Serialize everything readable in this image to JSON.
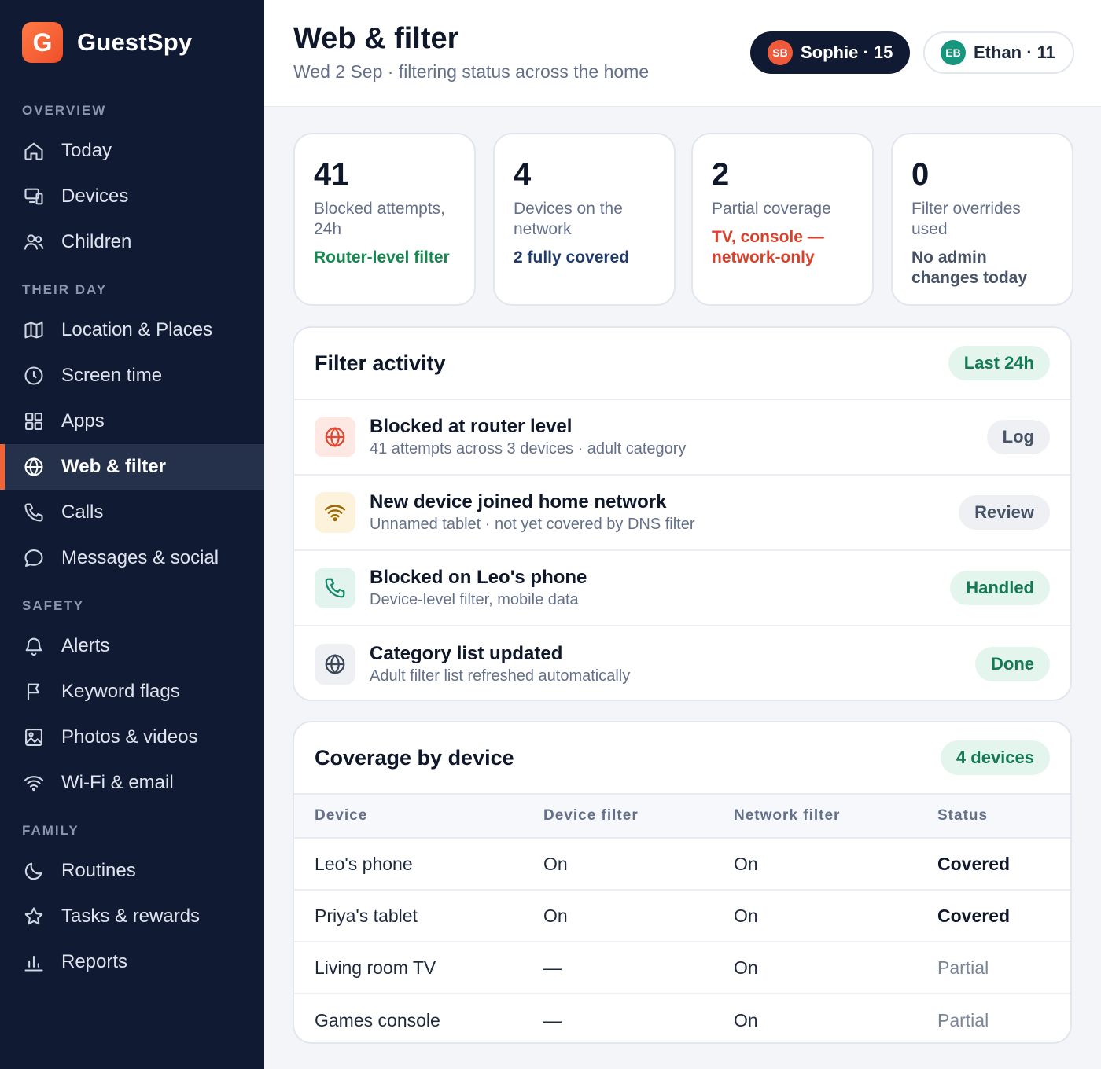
{
  "brand": {
    "logo_letter": "G",
    "name": "GuestSpy"
  },
  "sidebar": {
    "sections": [
      {
        "label": "OVERVIEW"
      },
      {
        "label": "THEIR DAY"
      },
      {
        "label": "SAFETY"
      },
      {
        "label": "FAMILY"
      }
    ],
    "items": [
      {
        "label": "Today",
        "icon": "home-icon"
      },
      {
        "label": "Devices",
        "icon": "devices-icon"
      },
      {
        "label": "Children",
        "icon": "people-icon"
      },
      {
        "label": "Location & Places",
        "icon": "map-icon"
      },
      {
        "label": "Screen time",
        "icon": "clock-icon"
      },
      {
        "label": "Apps",
        "icon": "grid-icon"
      },
      {
        "label": "Web & filter",
        "icon": "globe-icon",
        "active": true
      },
      {
        "label": "Calls",
        "icon": "phone-icon"
      },
      {
        "label": "Messages & social",
        "icon": "chat-icon"
      },
      {
        "label": "Alerts",
        "icon": "bell-icon"
      },
      {
        "label": "Keyword flags",
        "icon": "flag-icon"
      },
      {
        "label": "Photos & videos",
        "icon": "image-icon"
      },
      {
        "label": "Wi-Fi & email",
        "icon": "wifi-icon"
      },
      {
        "label": "Routines",
        "icon": "moon-icon"
      },
      {
        "label": "Tasks & rewards",
        "icon": "star-icon"
      },
      {
        "label": "Reports",
        "icon": "bar-chart-icon"
      }
    ]
  },
  "header": {
    "title": "Web & filter",
    "subtitle": "Wed 2 Sep · filtering status across the home",
    "children": [
      {
        "initials": "SB",
        "label": "Sophie · 15",
        "selected": true
      },
      {
        "initials": "EB",
        "label": "Ethan · 11",
        "selected": false
      }
    ]
  },
  "stats": [
    {
      "value": "41",
      "label": "Blocked attempts, 24h",
      "note": "Router-level filter",
      "note_color": "#16874f"
    },
    {
      "value": "4",
      "label": "Devices on the network",
      "note": "2 fully covered",
      "note_color": "#1f3a6b"
    },
    {
      "value": "2",
      "label": "Partial coverage",
      "note": "TV, console — network-only",
      "note_color": "#d9412b"
    },
    {
      "value": "0",
      "label": "Filter overrides used",
      "note": "No admin changes today",
      "note_color": "#475468"
    }
  ],
  "activity": {
    "title": "Filter activity",
    "chip": "Last 24h",
    "rows": [
      {
        "title": "Blocked at router level",
        "sub": "41 attempts across 3 devices · adult category",
        "action": "Log",
        "action_style": "gray",
        "icon": "globe-icon",
        "icon_bg": "#fde8e4",
        "icon_color": "#e0492f"
      },
      {
        "title": "New device joined home network",
        "sub": "Unnamed tablet · not yet covered by DNS filter",
        "action": "Review",
        "action_style": "gray",
        "icon": "wifi-icon",
        "icon_bg": "#fdf3dc",
        "icon_color": "#a06a05"
      },
      {
        "title": "Blocked on Leo's phone",
        "sub": "Device-level filter, mobile data",
        "action": "Handled",
        "action_style": "green",
        "icon": "phone-icon",
        "icon_bg": "#e3f4ef",
        "icon_color": "#148a6a"
      },
      {
        "title": "Category list updated",
        "sub": "Adult filter list refreshed automatically",
        "action": "Done",
        "action_style": "green",
        "icon": "globe-icon",
        "icon_bg": "#eef0f4",
        "icon_color": "#3b4658"
      }
    ]
  },
  "coverage": {
    "title": "Coverage by device",
    "chip": "4 devices",
    "columns": [
      "Device",
      "Device filter",
      "Network filter",
      "Status"
    ],
    "rows": [
      {
        "device": "Leo's phone",
        "device_filter": "On",
        "network_filter": "On",
        "status": "Covered"
      },
      {
        "device": "Priya's tablet",
        "device_filter": "On",
        "network_filter": "On",
        "status": "Covered"
      },
      {
        "device": "Living room TV",
        "device_filter": "—",
        "network_filter": "On",
        "status": "Partial"
      },
      {
        "device": "Games console",
        "device_filter": "—",
        "network_filter": "On",
        "status": "Partial"
      }
    ]
  },
  "colors": {
    "sidebar_bg": "#111a33",
    "accent": "#f1643a",
    "green": "#137a52"
  }
}
